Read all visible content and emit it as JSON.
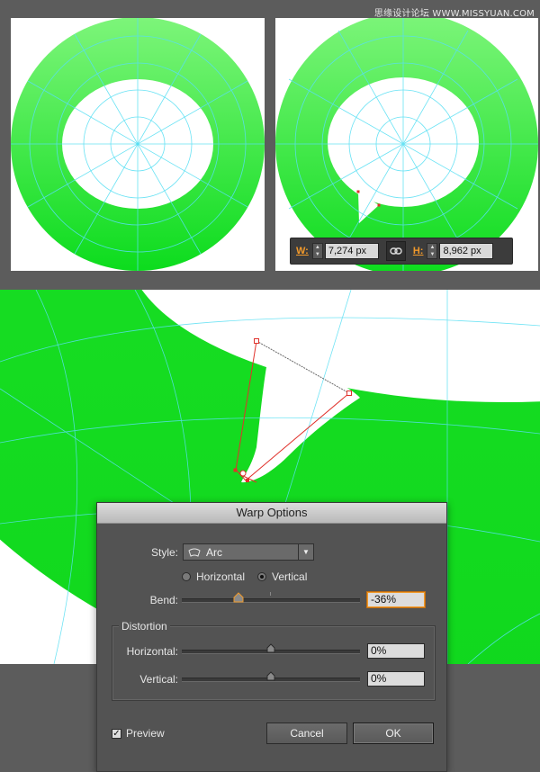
{
  "watermark": "思缘设计论坛 WWW.MISSYUAN.COM",
  "colors": {
    "ring_top": "#7df57a",
    "ring_bottom": "#0cdc1d",
    "guide": "#58dff3",
    "path": "#e0322c",
    "accent": "#f09a2b"
  },
  "transform": {
    "w_label": "W:",
    "w_value": "7,274 px",
    "h_label": "H:",
    "h_value": "8,962 px",
    "link_icon": "link-icon"
  },
  "dialog": {
    "title": "Warp Options",
    "style_label": "Style:",
    "style_value": "Arc",
    "style_icon": "arc-icon",
    "orientation": {
      "horizontal_label": "Horizontal",
      "vertical_label": "Vertical",
      "selected": "Vertical"
    },
    "bend_label": "Bend:",
    "bend_value": "-36%",
    "bend_fraction": 0.32,
    "distortion": {
      "group_label": "Distortion",
      "horizontal_label": "Horizontal:",
      "horizontal_value": "0%",
      "vertical_label": "Vertical:",
      "vertical_value": "0%"
    },
    "preview_label": "Preview",
    "preview_checked": true,
    "cancel_label": "Cancel",
    "ok_label": "OK"
  }
}
